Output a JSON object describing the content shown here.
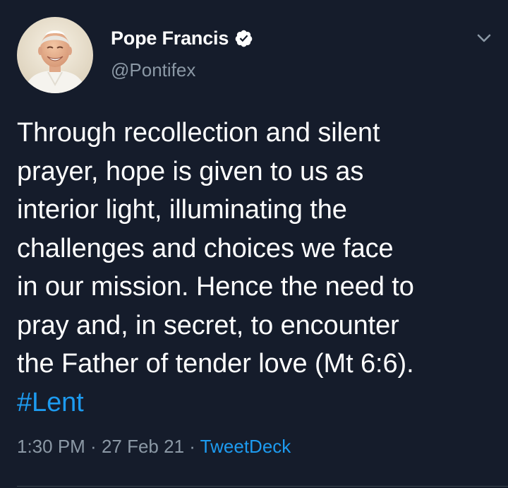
{
  "user": {
    "display_name": "Pope Francis",
    "handle": "@Pontifex",
    "verified": true
  },
  "tweet": {
    "lines": [
      "Through recollection and silent",
      "prayer, hope is given to us as",
      "interior light, illuminating the",
      "challenges and choices we face",
      "in our mission. Hence the need to",
      "pray and, in secret, to encounter",
      "the Father of tender love (Mt 6:6)."
    ],
    "hashtag": "#Lent"
  },
  "meta": {
    "time": "1:30 PM",
    "separator": " · ",
    "date": "27 Feb 21",
    "source": "TweetDeck"
  },
  "icons": {
    "verified": "verified-badge-icon",
    "caret": "chevron-down-icon"
  },
  "colors": {
    "background": "#151c2b",
    "text": "#ffffff",
    "muted": "#8b98a5",
    "link": "#1d9bf0"
  }
}
